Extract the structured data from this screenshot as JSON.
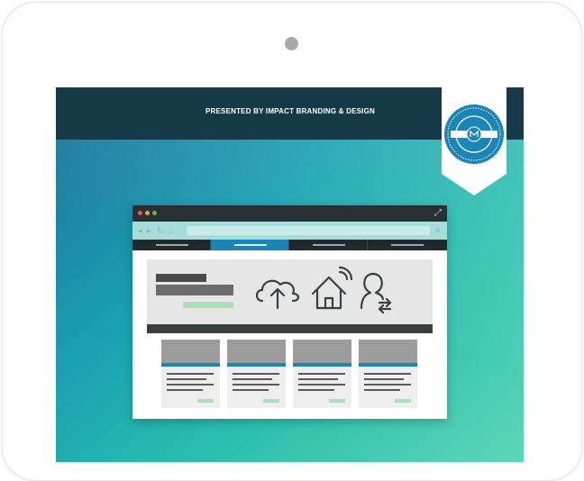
{
  "topbar": {
    "presented_text": "PRESENTED BY IMPACT BRANDING & DESIGN"
  },
  "colors": {
    "topbar": "#163a47",
    "accent_blue": "#1b85b8",
    "accent_green": "#a8e0b6",
    "badge": "#1b85b8"
  },
  "badge": {
    "icon": "impact-badge-icon"
  },
  "browser": {
    "title_dots": [
      "#e05a4e",
      "#e0a93a",
      "#5cb85c"
    ],
    "nav_tabs": [
      {
        "active": false
      },
      {
        "active": true
      },
      {
        "active": false
      },
      {
        "active": false
      }
    ],
    "hero_icons": [
      "cloud-upload-icon",
      "smart-home-icon",
      "user-switch-icon"
    ],
    "cards": [
      {},
      {},
      {},
      {}
    ]
  }
}
